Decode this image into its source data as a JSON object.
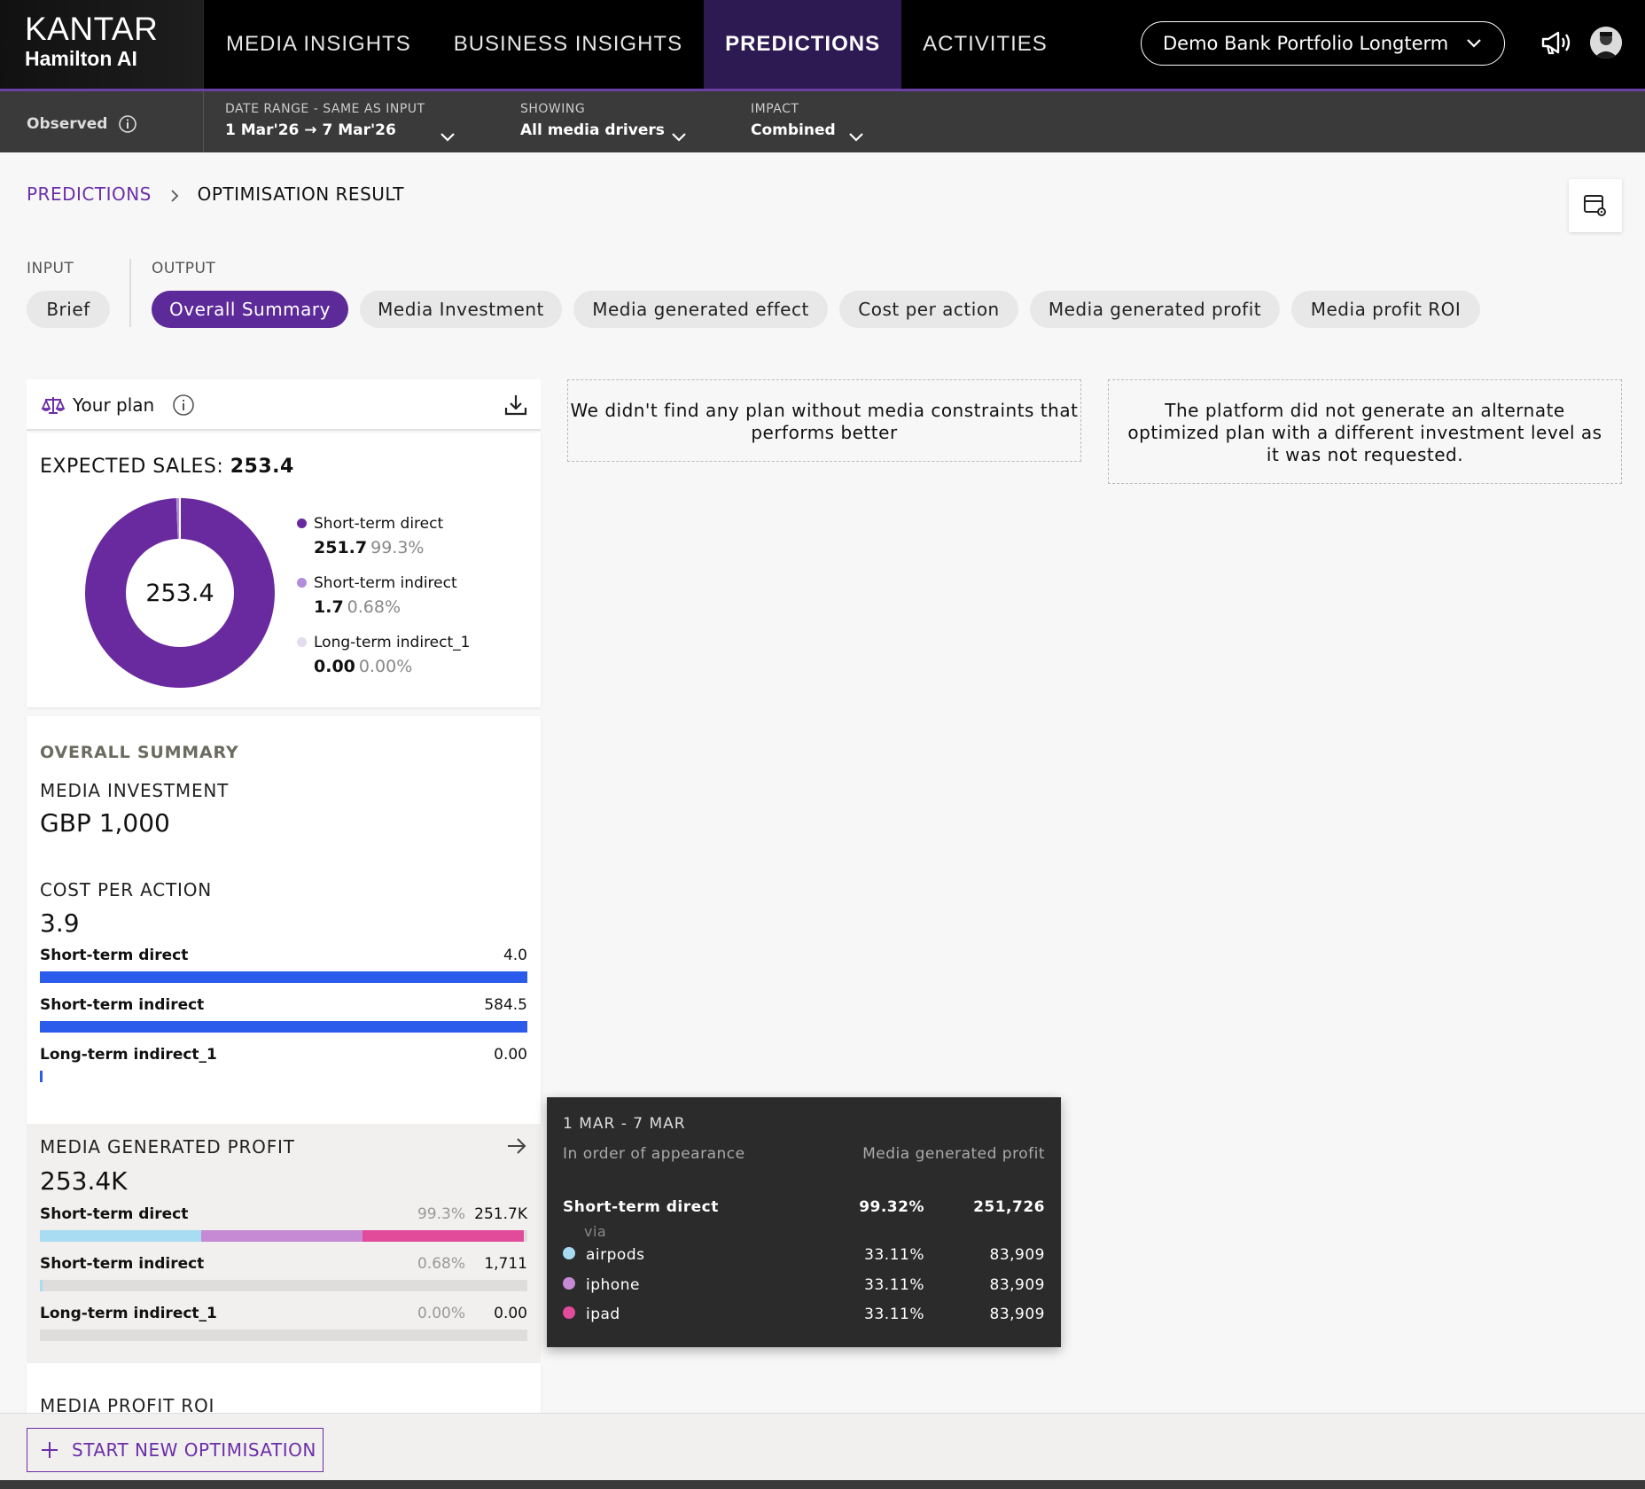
{
  "brand": {
    "line1": "KANTAR",
    "line2": "Hamilton AI"
  },
  "nav": {
    "items": [
      {
        "label": "MEDIA INSIGHTS"
      },
      {
        "label": "BUSINESS INSIGHTS"
      },
      {
        "label": "PREDICTIONS"
      },
      {
        "label": "ACTIVITIES"
      }
    ],
    "active": "PREDICTIONS",
    "portfolio": "Demo Bank Portfolio Longterm"
  },
  "filters": {
    "observed": "Observed",
    "date_label": "DATE RANGE - SAME AS INPUT",
    "date_value": "1 Mar'26 → 7 Mar'26",
    "showing_label": "SHOWING",
    "showing_value": "All media drivers",
    "impact_label": "IMPACT",
    "impact_value": "Combined"
  },
  "breadcrumb": {
    "parent": "PREDICTIONS",
    "current": "OPTIMISATION RESULT"
  },
  "sections": {
    "input": "INPUT",
    "output": "OUTPUT"
  },
  "tabs": {
    "brief": "Brief",
    "output": [
      "Overall Summary",
      "Media Investment",
      "Media generated effect",
      "Cost per action",
      "Media generated profit",
      "Media profit ROI"
    ],
    "active": "Overall Summary"
  },
  "plan": {
    "title": "Your plan",
    "expected_label": "EXPECTED SALES:",
    "expected_value": "253.4",
    "donut_center": "253.4",
    "legend": [
      {
        "name": "Short-term direct",
        "value": "251.7",
        "pct": "99.3%",
        "color": "#6a2a9f"
      },
      {
        "name": "Short-term indirect",
        "value": "1.7",
        "pct": "0.68%",
        "color": "#b28ddc"
      },
      {
        "name": "Long-term indirect_1",
        "value": "0.00",
        "pct": "0.00%",
        "color": "#e3dcef"
      }
    ]
  },
  "chart_data": {
    "type": "pie",
    "title": "EXPECTED SALES: 253.4",
    "center_label": "253.4",
    "categories": [
      "Short-term direct",
      "Short-term indirect",
      "Long-term indirect_1"
    ],
    "values": [
      251.7,
      1.7,
      0.0
    ],
    "percentages": [
      99.3,
      0.68,
      0.0
    ],
    "colors": [
      "#6a2a9f",
      "#b28ddc",
      "#e3dcef"
    ],
    "legend_position": "right"
  },
  "summary": {
    "title": "OVERALL SUMMARY",
    "media_investment_label": "MEDIA INVESTMENT",
    "media_investment_value": "GBP 1,000",
    "cpa_label": "COST PER ACTION",
    "cpa_value": "3.9",
    "cpa_rows": [
      {
        "name": "Short-term direct",
        "value": "4.0",
        "fill": 1.0
      },
      {
        "name": "Short-term indirect",
        "value": "584.5",
        "fill": 1.0
      },
      {
        "name": "Long-term indirect_1",
        "value": "0.00",
        "fill": 0.0
      }
    ],
    "bar_color": "#2b5bea"
  },
  "profit": {
    "label": "MEDIA GENERATED PROFIT",
    "value": "253.4K",
    "rows": [
      {
        "name": "Short-term direct",
        "pct": "99.3%",
        "value": "251.7K",
        "fill": 0.993
      },
      {
        "name": "Short-term indirect",
        "pct": "0.68%",
        "value": "1,711",
        "fill": 0.0068
      },
      {
        "name": "Long-term indirect_1",
        "pct": "0.00%",
        "value": "0.00",
        "fill": 0.0
      }
    ],
    "segment_colors": [
      "#a8dcf2",
      "#c58ad3",
      "#e24a9a"
    ]
  },
  "roi": {
    "label": "MEDIA PROFIT ROI"
  },
  "messages": {
    "no_better_plan": "We didn't find any plan without media constraints that performs better",
    "no_alternate": "The platform did not generate an alternate optimized plan with a different investment level as it was not requested."
  },
  "tooltip": {
    "date": "1 MAR - 7 MAR",
    "subtitle": "In order of appearance",
    "metric": "Media generated profit",
    "driver": {
      "name": "Short-term direct",
      "pct": "99.32%",
      "value": "251,726"
    },
    "via": "via",
    "rows": [
      {
        "name": "airpods",
        "pct": "33.11%",
        "value": "83,909",
        "color": "#a8dcf2"
      },
      {
        "name": "iphone",
        "pct": "33.11%",
        "value": "83,909",
        "color": "#c58ad3"
      },
      {
        "name": "ipad",
        "pct": "33.11%",
        "value": "83,909",
        "color": "#e24a9a"
      }
    ]
  },
  "footer": {
    "start_button": "START NEW OPTIMISATION"
  }
}
